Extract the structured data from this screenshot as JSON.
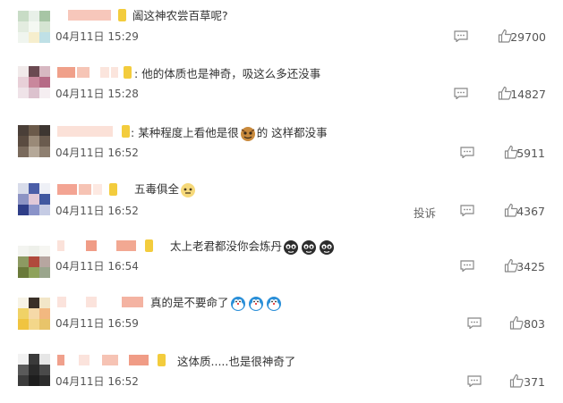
{
  "comments": [
    {
      "text": "阖这神农尝百草呢?",
      "date": "04月11日 15:29",
      "likes": "29700"
    },
    {
      "text": "他的体质也是神奇，吸这么多还没事",
      "date": "04月11日 15:28",
      "likes": "14827"
    },
    {
      "text_before": "某种程度上看他是很",
      "text_after": "的 这样都没事",
      "date": "04月11日 16:52",
      "likes": "5911"
    },
    {
      "text": "五毒俱全",
      "date": "04月11日 16:52",
      "likes": "4367",
      "report": "投诉"
    },
    {
      "text": "太上老君都没你会炼丹",
      "date": "04月11日 16:54",
      "likes": "3425"
    },
    {
      "text": "真的是不要命了",
      "date": "04月11日 16:59",
      "likes": "803"
    },
    {
      "text": "这体质.....也是很神奇了",
      "date": "04月11日 16:52",
      "likes": "371"
    }
  ],
  "colors": {
    "name_blur": "#f4b8a8",
    "badge": "#f3cc3d",
    "icon": "#888888"
  },
  "icons": [
    "reply-icon",
    "like-icon",
    "emoji-icon"
  ]
}
